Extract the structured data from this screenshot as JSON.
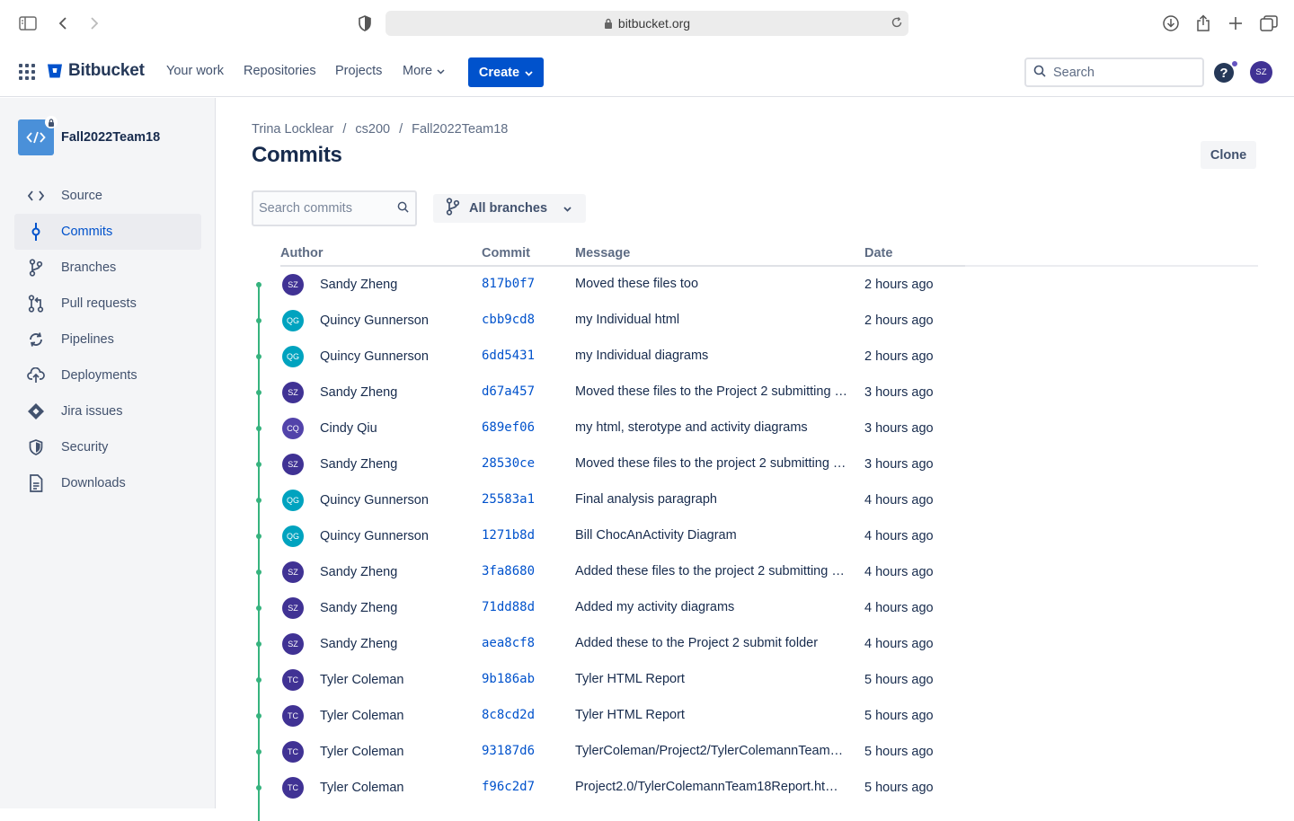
{
  "browser": {
    "url": "bitbucket.org"
  },
  "header": {
    "brand": "Bitbucket",
    "nav": [
      "Your work",
      "Repositories",
      "Projects",
      "More"
    ],
    "create_label": "Create",
    "search_placeholder": "Search",
    "help_label": "?",
    "user_initials": "SZ",
    "brand_color": "#0052cc"
  },
  "sidebar": {
    "repo_name": "Fall2022Team18",
    "items": [
      {
        "label": "Source",
        "icon": "code-icon"
      },
      {
        "label": "Commits",
        "icon": "commit-icon",
        "active": true
      },
      {
        "label": "Branches",
        "icon": "branch-icon"
      },
      {
        "label": "Pull requests",
        "icon": "pull-request-icon"
      },
      {
        "label": "Pipelines",
        "icon": "pipelines-icon"
      },
      {
        "label": "Deployments",
        "icon": "deployments-icon"
      },
      {
        "label": "Jira issues",
        "icon": "jira-icon"
      },
      {
        "label": "Security",
        "icon": "shield-icon"
      },
      {
        "label": "Downloads",
        "icon": "document-icon"
      }
    ]
  },
  "main": {
    "breadcrumbs": [
      "Trina Locklear",
      "cs200",
      "Fall2022Team18"
    ],
    "crumb_sep": "/",
    "title": "Commits",
    "clone_label": "Clone",
    "search_placeholder": "Search commits",
    "branch_filter": "All branches",
    "columns": [
      "Author",
      "Commit",
      "Message",
      "Date"
    ],
    "commits": [
      {
        "initials": "SZ",
        "author": "Sandy Zheng",
        "hash": "817b0f7",
        "message": "Moved these files too",
        "date": "2 hours ago",
        "color": "#403294"
      },
      {
        "initials": "QG",
        "author": "Quincy Gunnerson",
        "hash": "cbb9cd8",
        "message": "my Individual html",
        "date": "2 hours ago",
        "color": "#00a3bf"
      },
      {
        "initials": "QG",
        "author": "Quincy Gunnerson",
        "hash": "6dd5431",
        "message": "my Individual diagrams",
        "date": "2 hours ago",
        "color": "#00a3bf"
      },
      {
        "initials": "SZ",
        "author": "Sandy Zheng",
        "hash": "d67a457",
        "message": "Moved these files to the Project 2 submitting …",
        "date": "3 hours ago",
        "color": "#403294"
      },
      {
        "initials": "CQ",
        "author": "Cindy Qiu",
        "hash": "689ef06",
        "message": "my html, sterotype and activity diagrams",
        "date": "3 hours ago",
        "color": "#5243aa"
      },
      {
        "initials": "SZ",
        "author": "Sandy Zheng",
        "hash": "28530ce",
        "message": "Moved these files to the project 2 submitting …",
        "date": "3 hours ago",
        "color": "#403294"
      },
      {
        "initials": "QG",
        "author": "Quincy Gunnerson",
        "hash": "25583a1",
        "message": "Final analysis paragraph",
        "date": "4 hours ago",
        "color": "#00a3bf"
      },
      {
        "initials": "QG",
        "author": "Quincy Gunnerson",
        "hash": "1271b8d",
        "message": "Bill ChocAnActivity Diagram",
        "date": "4 hours ago",
        "color": "#00a3bf"
      },
      {
        "initials": "SZ",
        "author": "Sandy Zheng",
        "hash": "3fa8680",
        "message": "Added these files to the project 2 submitting …",
        "date": "4 hours ago",
        "color": "#403294"
      },
      {
        "initials": "SZ",
        "author": "Sandy Zheng",
        "hash": "71dd88d",
        "message": "Added my activity diagrams",
        "date": "4 hours ago",
        "color": "#403294"
      },
      {
        "initials": "SZ",
        "author": "Sandy Zheng",
        "hash": "aea8cf8",
        "message": "Added these to the Project 2 submit folder",
        "date": "4 hours ago",
        "color": "#403294"
      },
      {
        "initials": "TC",
        "author": "Tyler Coleman",
        "hash": "9b186ab",
        "message": "Tyler HTML Report",
        "date": "5 hours ago",
        "color": "#403294"
      },
      {
        "initials": "TC",
        "author": "Tyler Coleman",
        "hash": "8c8cd2d",
        "message": "Tyler HTML Report",
        "date": "5 hours ago",
        "color": "#403294"
      },
      {
        "initials": "TC",
        "author": "Tyler Coleman",
        "hash": "93187d6",
        "message": "TylerColeman/Project2/TylerColemannTeam1…",
        "date": "5 hours ago",
        "color": "#403294"
      },
      {
        "initials": "TC",
        "author": "Tyler Coleman",
        "hash": "f96c2d7",
        "message": "Project2.0/TylerColemannTeam18Report.html…",
        "date": "5 hours ago",
        "color": "#403294"
      }
    ]
  }
}
